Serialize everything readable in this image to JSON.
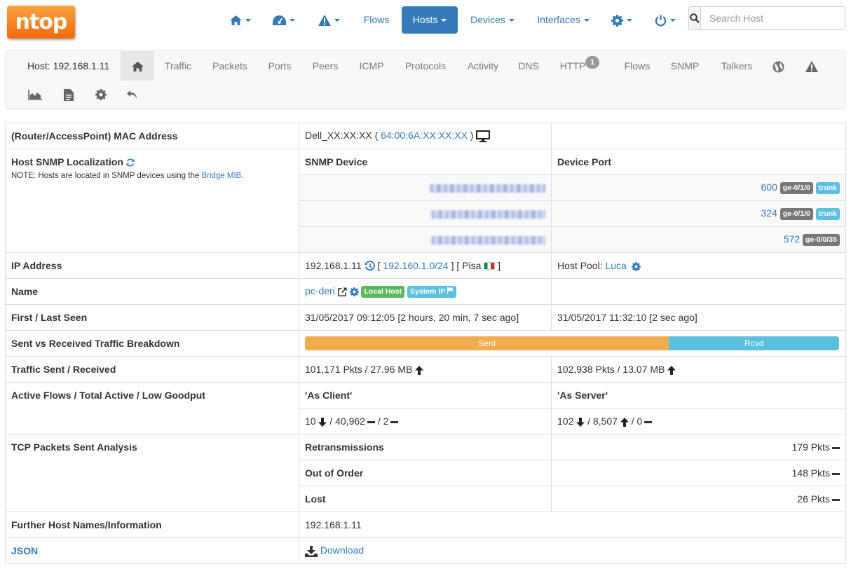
{
  "navbar": {
    "logo_text": "ntop",
    "items": [
      {
        "label": "",
        "icon": "home-icon"
      },
      {
        "label": "",
        "icon": "dashboard-icon"
      },
      {
        "label": "",
        "icon": "alert-icon"
      },
      {
        "label": "Flows"
      },
      {
        "label": "Hosts",
        "active": true
      },
      {
        "label": "Devices"
      },
      {
        "label": "Interfaces"
      },
      {
        "label": "",
        "icon": "gear-icon"
      },
      {
        "label": "",
        "icon": "power-icon"
      }
    ],
    "search": {
      "placeholder": "Search Host",
      "value": ""
    }
  },
  "host_nav": {
    "host_label": "Host: 192.168.1.11",
    "tabs": [
      "Traffic",
      "Packets",
      "Ports",
      "Peers",
      "ICMP",
      "Protocols",
      "Activity",
      "DNS",
      "HTTP",
      "Flows",
      "SNMP",
      "Talkers"
    ],
    "http_badge": "1",
    "icons": [
      "home-icon",
      "globe-icon",
      "alert-icon",
      "area-chart-icon",
      "document-icon",
      "gear-icon",
      "undo-icon"
    ]
  },
  "table": {
    "mac": {
      "label": "(Router/AccessPoint) MAC Address",
      "vendor": "Dell_XX:XX:XX",
      "address": "64:00:6A:XX:XX:XX"
    },
    "snmp": {
      "label": "Host SNMP Localization",
      "note_prefix": "NOTE: Hosts are located in SNMP devices using the ",
      "note_link": "Bridge MIB",
      "note_suffix": ".",
      "col_device": "SNMP Device",
      "col_port": "Device Port",
      "rows": [
        {
          "port": "600",
          "iface": "ge-0/1/0",
          "tag": "trunk"
        },
        {
          "port": "324",
          "iface": "ge-0/1/0",
          "tag": "trunk"
        },
        {
          "port": "572",
          "iface": "ge-0/0/35",
          "tag": ""
        }
      ]
    },
    "ip": {
      "label": "IP Address",
      "value": "192.168.1.11",
      "network": "192.160.1.0/24",
      "city": "Pisa",
      "pool_label": "Host Pool:",
      "pool": "Luca"
    },
    "name": {
      "label": "Name",
      "value": "pc-deri",
      "badge_local": "Local Host",
      "badge_system": "System IP"
    },
    "seen": {
      "label": "First / Last Seen",
      "first": "31/05/2017 09:12:05 [2 hours, 20 min, 7 sec ago]",
      "last": "31/05/2017 11:32:10 [2 sec ago]"
    },
    "breakdown": {
      "label": "Sent vs Received Traffic Breakdown",
      "sent_label": "Sent",
      "rcvd_label": "Rcvd",
      "sent_fraction": 0.6817
    },
    "traffic": {
      "label": "Traffic Sent / Received",
      "sent": "101,171 Pkts / 27.96 MB",
      "rcvd": "102,938 Pkts / 13.07 MB"
    },
    "flows": {
      "label": "Active Flows / Total Active / Low Goodput",
      "client_hdr": "'As Client'",
      "server_hdr": "'As Server'",
      "client_active": "10",
      "client_total": "40,962",
      "client_low": "2",
      "server_active": "102",
      "server_total": "8,507",
      "server_low": "0"
    },
    "tcp": {
      "label": "TCP Packets Sent Analysis",
      "rows": [
        {
          "name": "Retransmissions",
          "value": "179 Pkts"
        },
        {
          "name": "Out of Order",
          "value": "148 Pkts"
        },
        {
          "name": "Lost",
          "value": "26 Pkts"
        }
      ]
    },
    "further": {
      "label": "Further Host Names/Information",
      "value": "192.168.1.11"
    },
    "json": {
      "label": "JSON",
      "download": "Download"
    }
  }
}
